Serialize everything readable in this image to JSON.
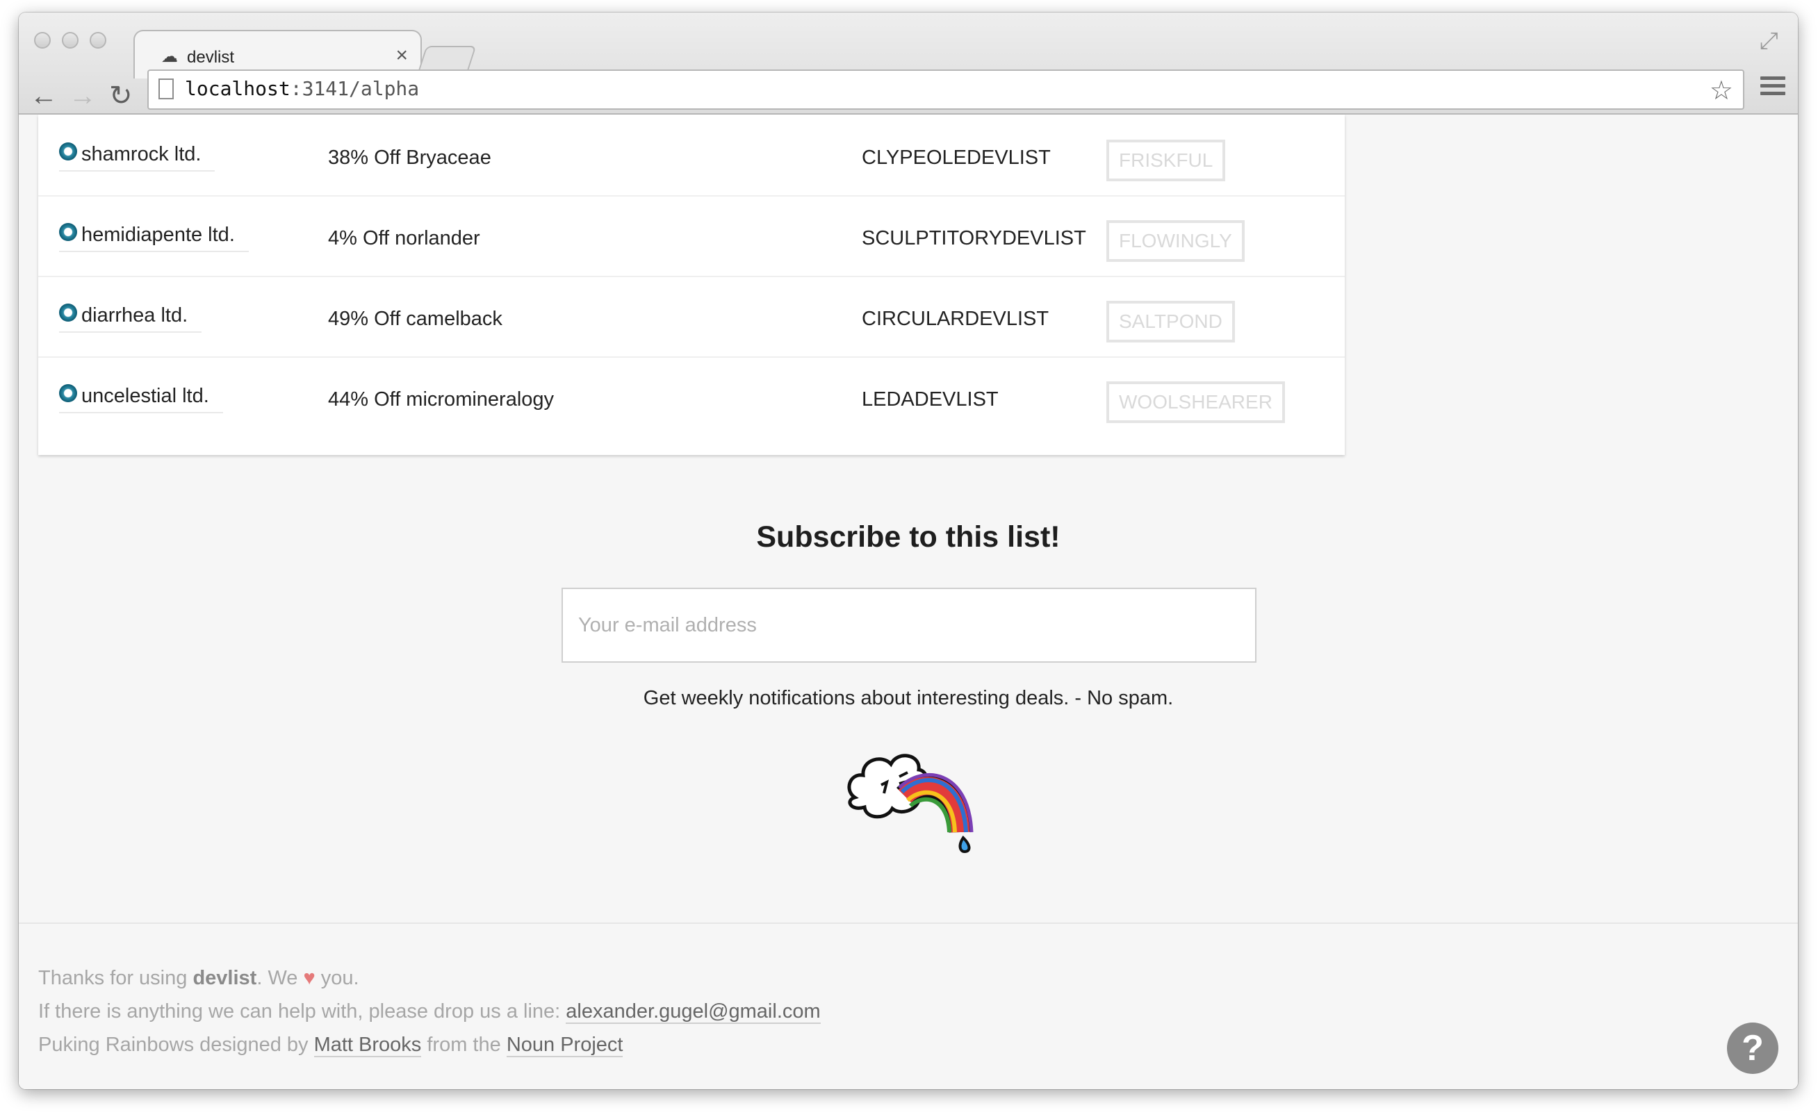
{
  "browser": {
    "tab_title": "devlist",
    "tab_close": "×",
    "url_host": "localhost",
    "url_rest": ":3141/alpha",
    "back_glyph": "←",
    "forward_glyph": "→",
    "reload_glyph": "↻",
    "star_glyph": "☆",
    "fullscreen_glyph": "⤢",
    "favicon_glyph": "☁"
  },
  "deals": [
    {
      "company": "shamrock ltd.",
      "offer": "38% Off Bryaceae",
      "code": "CLYPEOLEDEVLIST",
      "coupon": "FRISKFUL"
    },
    {
      "company": "hemidiapente ltd.",
      "offer": "4% Off norlander",
      "code": "SCULPTITORYDEVLIST",
      "coupon": "FLOWINGLY"
    },
    {
      "company": "diarrhea ltd.",
      "offer": "49% Off camelback",
      "code": "CIRCULARDEVLIST",
      "coupon": "SALTPOND"
    },
    {
      "company": "uncelestial ltd.",
      "offer": "44% Off micromineralogy",
      "code": "LEDADEVLIST",
      "coupon": "WOOLSHEARER"
    }
  ],
  "subscribe": {
    "title": "Subscribe to this list!",
    "placeholder": "Your e-mail address",
    "note": "Get weekly notifications about interesting deals. - No spam."
  },
  "footer": {
    "line1_pre": "Thanks for using ",
    "brand": "devlist",
    "line1_mid": ". We ",
    "heart": "♥",
    "line1_post": " you.",
    "line2_pre": "If there is anything we can help with, please drop us a line: ",
    "email": "alexander.gugel@gmail.com",
    "line3_pre": "Puking Rainbows designed by ",
    "designer": "Matt Brooks",
    "line3_mid": " from the ",
    "project": "Noun Project",
    "help_glyph": "?"
  },
  "colors": {
    "accent_dot": "#2f8ea8",
    "heart": "#e57a7a",
    "coupon_border": "#e4e4e4"
  }
}
